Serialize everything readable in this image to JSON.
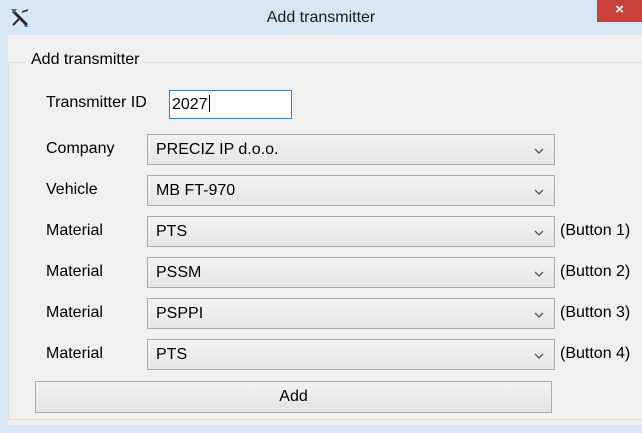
{
  "window": {
    "title": "Add transmitter",
    "close_label": "×"
  },
  "group": {
    "legend": "Add transmitter"
  },
  "transmitter_id": {
    "label": "Transmitter ID",
    "value": "2027"
  },
  "company": {
    "label": "Company",
    "selected": "PRECIZ IP d.o.o."
  },
  "vehicle": {
    "label": "Vehicle",
    "selected": "MB FT-970"
  },
  "materials": [
    {
      "label": "Material",
      "selected": "PTS",
      "note": "(Button 1)"
    },
    {
      "label": "Material",
      "selected": "PSSM",
      "note": "(Button 2)"
    },
    {
      "label": "Material",
      "selected": "PSPPI",
      "note": "(Button 3)"
    },
    {
      "label": "Material",
      "selected": "PTS",
      "note": "(Button 4)"
    }
  ],
  "add_button": {
    "label": "Add"
  },
  "colors": {
    "title_bg": "#d8e6f4",
    "close_bg": "#c8413a",
    "client_bg": "#f0f0f0",
    "input_border": "#3c7fb1"
  }
}
